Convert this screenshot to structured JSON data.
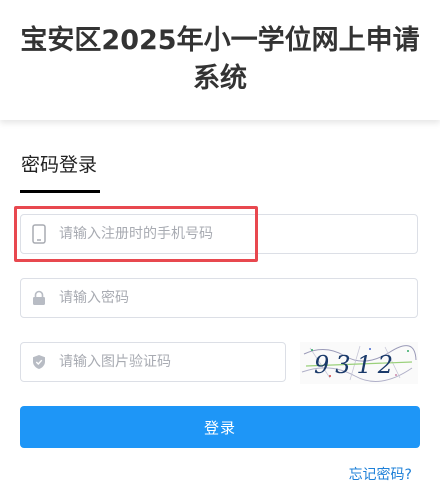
{
  "header": {
    "title": "宝安区2025年小一学位网上申请系统"
  },
  "tabs": [
    {
      "label": "密码登录",
      "active": true
    }
  ],
  "form": {
    "phone": {
      "placeholder": "请输入注册时的手机号码",
      "icon": "mobile-phone-icon"
    },
    "password": {
      "placeholder": "请输入密码",
      "icon": "lock-icon"
    },
    "captcha": {
      "placeholder": "请输入图片验证码",
      "icon": "shield-icon",
      "image_text": "9312"
    }
  },
  "login_button": {
    "label": "登录"
  },
  "forgot_link": {
    "label": "忘记密码?"
  },
  "colors": {
    "primary": "#1e96f7",
    "link": "#1e80d8",
    "highlight": "#e8484f"
  }
}
